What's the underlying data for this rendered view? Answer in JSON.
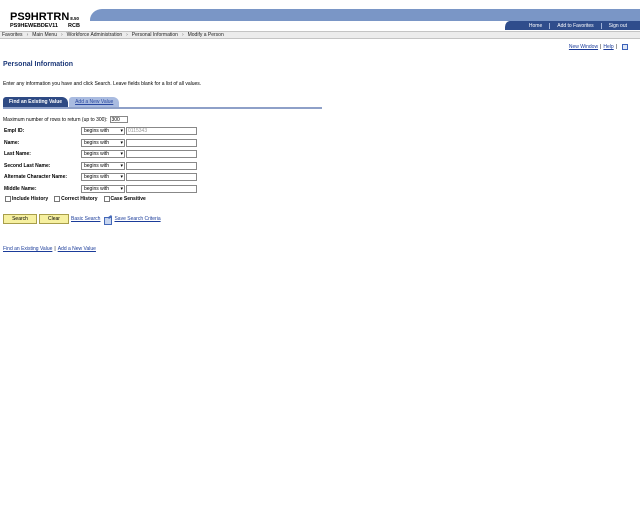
{
  "header": {
    "brand": "PS9HRTRN",
    "brand_version": "8.50",
    "db_name": "PS9HEWEBDEV11",
    "db_suffix": "RCB",
    "links": [
      "Home",
      "Add to Favorites",
      "Sign out"
    ]
  },
  "breadcrumb": [
    "Favorites",
    "Main Menu",
    "Workforce Administration",
    "Personal Information",
    "Modify a Person"
  ],
  "top_links": {
    "new_window": "New Window",
    "help": "Help"
  },
  "page_title": "Personal Information",
  "instructions": "Enter any information you have and click Search. Leave fields blank for a list of all values.",
  "tabs": {
    "active": "Find an Existing Value",
    "inactive": "Add a New Value"
  },
  "max_rows": {
    "label": "Maximum number of rows to return (up to 300):",
    "value": "300"
  },
  "fields": [
    {
      "label": "Empl ID:",
      "operator": "begins with",
      "value": "0115343"
    },
    {
      "label": "Name:",
      "operator": "begins with",
      "value": ""
    },
    {
      "label": "Last Name:",
      "operator": "begins with",
      "value": ""
    },
    {
      "label": "Second Last Name:",
      "operator": "begins with",
      "value": ""
    },
    {
      "label": "Alternate Character Name:",
      "operator": "begins with",
      "value": ""
    },
    {
      "label": "Middle Name:",
      "operator": "begins with",
      "value": ""
    }
  ],
  "checkboxes": [
    "Include History",
    "Correct History",
    "Case Sensitive"
  ],
  "buttons": {
    "search": "Search",
    "clear": "Clear",
    "basic_search": "Basic Search",
    "save_criteria": "Save Search Criteria"
  },
  "bottom_links": {
    "find": "Find an Existing Value",
    "add": "Add a New Value"
  }
}
